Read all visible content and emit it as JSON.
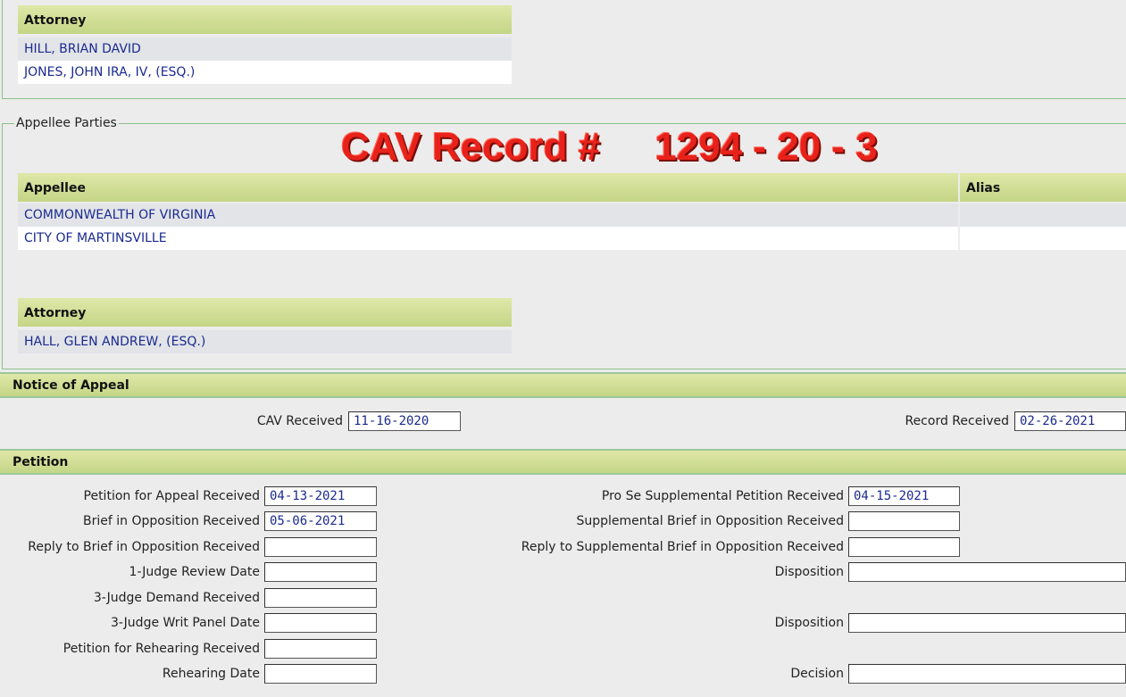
{
  "appellant_attorneys": {
    "header": "Attorney",
    "rows": [
      "HILL, BRIAN DAVID",
      "JONES, JOHN IRA, IV, (ESQ.)"
    ]
  },
  "appellee_parties": {
    "legend": "Appellee Parties",
    "banner": "CAV Record #     1294 - 20 - 3",
    "table": {
      "columns": [
        "Appellee",
        "Alias"
      ],
      "rows": [
        {
          "name": "COMMONWEALTH OF VIRGINIA",
          "alias": ""
        },
        {
          "name": "CITY OF MARTINSVILLE",
          "alias": ""
        }
      ]
    },
    "attorney": {
      "header": "Attorney",
      "rows": [
        "HALL, GLEN ANDREW, (ESQ.)"
      ]
    }
  },
  "notice_of_appeal": {
    "title": "Notice of Appeal",
    "cav_received_label": "CAV Received",
    "cav_received_value": "11-16-2020",
    "record_received_label": "Record Received",
    "record_received_value": "02-26-2021"
  },
  "petition": {
    "title": "Petition",
    "left": [
      {
        "label": "Petition for Appeal Received",
        "value": "04-13-2021"
      },
      {
        "label": "Brief in Opposition Received",
        "value": "05-06-2021"
      },
      {
        "label": "Reply to Brief in Opposition Received",
        "value": ""
      },
      {
        "label": "1-Judge Review Date",
        "value": ""
      },
      {
        "label": "3-Judge Demand Received",
        "value": ""
      },
      {
        "label": "3-Judge Writ Panel Date",
        "value": ""
      },
      {
        "label": "Petition for Rehearing Received",
        "value": ""
      },
      {
        "label": "Rehearing Date",
        "value": ""
      }
    ],
    "right": [
      {
        "label": "Pro Se Supplemental Petition Received",
        "value": "04-15-2021"
      },
      {
        "label": "Supplemental Brief in Opposition Received",
        "value": ""
      },
      {
        "label": "Reply to Supplemental Brief in Opposition Received",
        "value": ""
      },
      {
        "label": "Disposition",
        "value": ""
      },
      {
        "label": "Disposition",
        "value": ""
      },
      {
        "label": "Decision",
        "value": ""
      }
    ]
  }
}
